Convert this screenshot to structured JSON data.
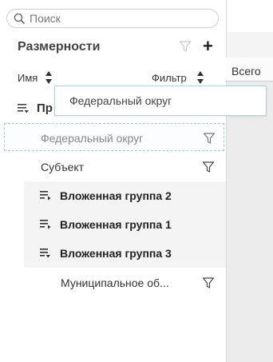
{
  "search": {
    "placeholder": "Поиск"
  },
  "dimensions": {
    "title": "Размерности",
    "columns": {
      "name": "Имя",
      "filter": "Фильтр"
    },
    "group_label": "Пр",
    "drag_tooltip": "Федеральный округ",
    "drop_target_label": "Федеральный округ",
    "items": [
      {
        "label": "Субъект"
      }
    ],
    "nested_groups": [
      {
        "label": "Вложенная группа 2"
      },
      {
        "label": "Вложенная группа 1"
      },
      {
        "label": "Вложенная группа 3"
      }
    ],
    "sub_item": {
      "label": "Муниципальное об..."
    }
  },
  "table": {
    "total_header": "Всего"
  },
  "colors": {
    "drop_border": "#9fcbd9",
    "nested_bg": "#f4f4f4"
  }
}
